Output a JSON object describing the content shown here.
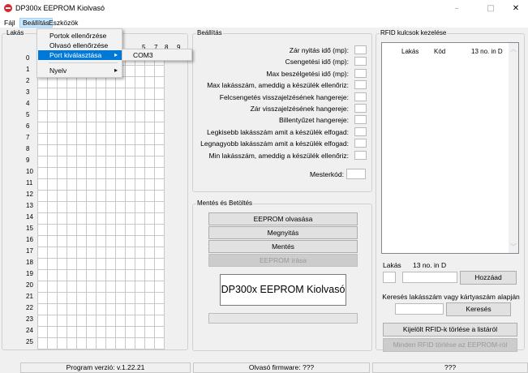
{
  "window": {
    "title": "DP300x EEPROM Kiolvasó",
    "minimize": "–",
    "maximize": "□",
    "close": "✕"
  },
  "menu": {
    "file": "Fájl",
    "settings": "Beállítás",
    "tools": "Eszközök"
  },
  "dropdown": {
    "items": [
      "Portok ellenőrzése",
      "Olvasó ellenőrzése",
      "Port kiválasztása",
      "Nyelv"
    ],
    "arrow": "▸",
    "submenu_item": "COM3"
  },
  "grid": {
    "legend": "Lakás",
    "col_headers": [
      "5",
      "7",
      "8",
      "9"
    ],
    "row_labels": [
      "0",
      "1",
      "2",
      "3",
      "4",
      "5",
      "6",
      "7",
      "8",
      "9",
      "10",
      "11",
      "12",
      "13",
      "14",
      "15",
      "16",
      "17",
      "18",
      "19",
      "20",
      "21",
      "22",
      "23",
      "24",
      "25"
    ]
  },
  "settings": {
    "legend": "Beállítás",
    "labels": [
      "Zár nyitás idő (mp):",
      "Csengetési idő (mp):",
      "Max beszélgetési idő (mp):",
      "Max lakásszám, ameddig a készülék ellenőriz:",
      "Felcsengetés visszajelzésének hangereje:",
      "Zár visszajelzésének hangereje:",
      "Billentyűzet hangereje:",
      "Legkisebb lakásszám amit a készülék elfogad:",
      "Legnagyobb lakásszám amit a készülék elfogad:",
      "Min lakásszám, ameddig a készülék ellenőriz:"
    ],
    "master_label": "Mesterkód:"
  },
  "save_load": {
    "legend": "Mentés és Betöltés",
    "read_eeprom": "EEPROM olvasása",
    "open": "Megnyitás",
    "save": "Mentés",
    "write_eeprom": "EEPROM írása",
    "product_name": "DP300x EEPROM Kiolvasó",
    "progress": 0
  },
  "rfid": {
    "legend": "RFID kulcsok kezelése",
    "columns": [
      "Lakás",
      "Kód",
      "13 no. in D"
    ],
    "flat_label": "Lakás",
    "num_label": "13 no. in D",
    "add": "Hozzáad",
    "search_label": "Keresés lakásszám vagy kártyaszám alapján",
    "search_button": "Keresés",
    "delete_selected": "Kijelölt RFID-k törlése a listáról",
    "delete_all": "Minden RFID törlése az EEPROM-ról"
  },
  "status": {
    "program_version": "Program verzió: v.1.22.21",
    "firmware": "Olvasó firmware: ???",
    "third": "???"
  }
}
